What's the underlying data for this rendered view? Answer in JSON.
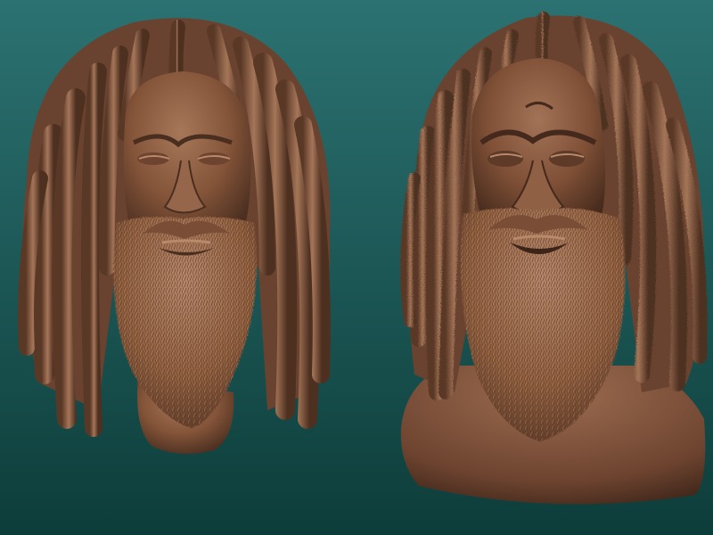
{
  "scene": {
    "description_free": true,
    "background": {
      "top_color": "#2c7272",
      "bottom_color": "#0d3d3a"
    },
    "material": {
      "base_color": "#8a5a40",
      "highlight_color": "#b98a6a",
      "shadow_color": "#4a2e20",
      "deep_shadow_color": "#2c1a12"
    },
    "sculpts": [
      {
        "id": "left-head"
      },
      {
        "id": "right-head"
      }
    ]
  }
}
